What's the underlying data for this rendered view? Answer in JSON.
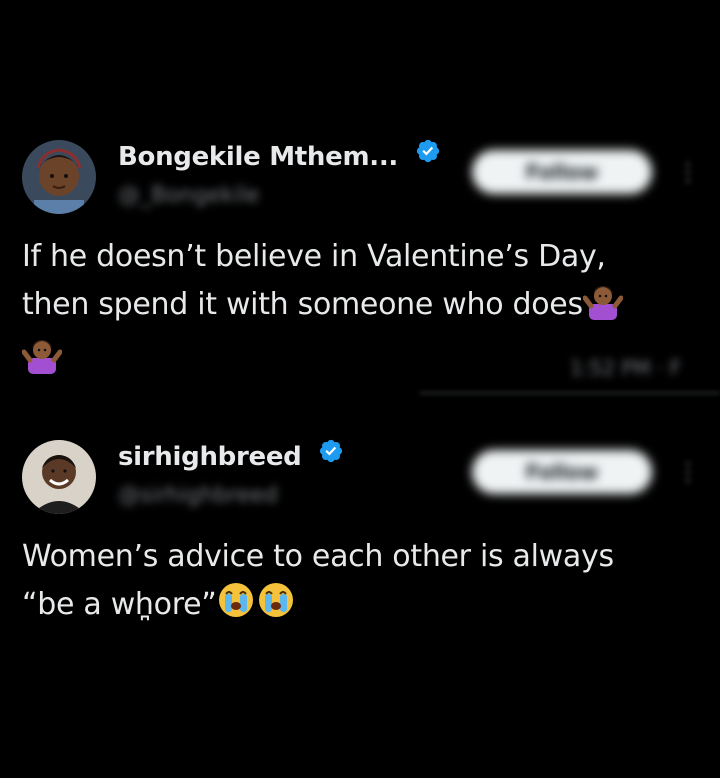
{
  "tweets": [
    {
      "display_name": "Bongekile Mthem...",
      "handle": "@_Bongekile",
      "follow_label": "Follow",
      "more_label": "⋮",
      "text_line1": "If he doesn’t believe in Valentine’s Day,",
      "text_line2": "then spend it with someone who does",
      "emoji_1": "shrug-woman",
      "emoji_2": "shrug-woman",
      "timestamp": "1:52 PM · F",
      "verified_color": "#1d9bf0"
    },
    {
      "display_name": "sirhighbreed",
      "handle": "@sirhighbreed",
      "follow_label": "Follow",
      "more_label": "⋮",
      "text_line1": "Women’s advice to each other is always",
      "text_line2": "“be a wh̪ore”",
      "emoji_1": "loudly-crying-face",
      "emoji_2": "loudly-crying-face",
      "verified_color": "#1d9bf0"
    }
  ],
  "theme": {
    "background": "#000000",
    "text": "#e7e9ea",
    "secondary": "#71767b"
  }
}
